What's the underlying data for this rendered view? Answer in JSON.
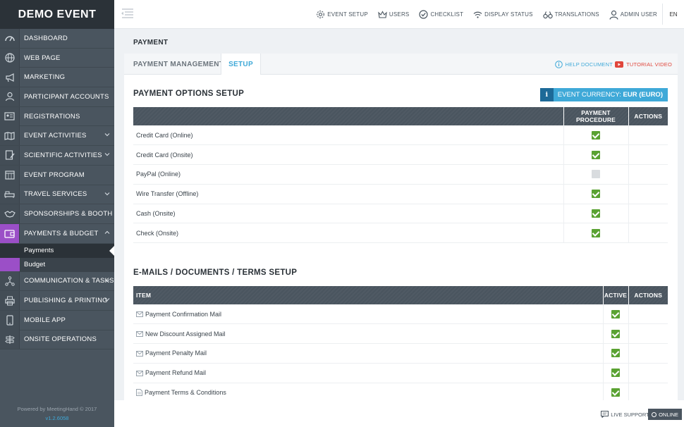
{
  "sidebar": {
    "brand": "DEMO EVENT",
    "items": [
      {
        "label": "DASHBOARD",
        "icon": "dashboard-icon"
      },
      {
        "label": "WEB PAGE",
        "icon": "globe-icon"
      },
      {
        "label": "MARKETING",
        "icon": "megaphone-icon"
      },
      {
        "label": "PARTICIPANT ACCOUNTS",
        "icon": "users-icon"
      },
      {
        "label": "REGISTRATIONS",
        "icon": "id-card-icon"
      },
      {
        "label": "EVENT ACTIVITIES",
        "icon": "map-icon"
      },
      {
        "label": "SCIENTIFIC ACTIVITIES",
        "icon": "document-pen-icon"
      },
      {
        "label": "EVENT PROGRAM",
        "icon": "calendar-icon"
      },
      {
        "label": "TRAVEL SERVICES",
        "icon": "bed-icon"
      },
      {
        "label": "SPONSORSHIPS & BOOTH",
        "icon": "handshake-icon"
      },
      {
        "label": "PAYMENTS & BUDGET",
        "icon": "wallet-icon"
      },
      {
        "label": "COMMUNICATION & TASKS",
        "icon": "network-icon"
      },
      {
        "label": "PUBLISHING & PRINTING",
        "icon": "printer-icon"
      },
      {
        "label": "MOBILE APP",
        "icon": "mobile-icon"
      },
      {
        "label": "ONSITE OPERATIONS",
        "icon": "signpost-icon"
      }
    ],
    "sub_items": [
      "Payments",
      "Budget"
    ],
    "footer": "Powered by MeetingHand © 2017",
    "version": "v1.2.6058"
  },
  "topbar": {
    "links": [
      "EVENT SETUP",
      "USERS",
      "CHECKLIST",
      "DISPLAY STATUS",
      "TRANSLATIONS",
      "ADMIN USER"
    ],
    "lang": "EN"
  },
  "page": {
    "title": "PAYMENT",
    "tabs": [
      "PAYMENT MANAGEMENT",
      "SETUP"
    ],
    "help_document": "HELP DOCUMENT",
    "tutorial_video": "TUTORIAL VIDEO"
  },
  "payment_options": {
    "title": "PAYMENT OPTIONS SETUP",
    "currency_label": "EVENT CURRENCY:",
    "currency_value": "EUR (EURO)",
    "headers": [
      "PAYMENT PROCEDURE",
      "ACTIONS"
    ],
    "rows": [
      {
        "name": "Credit Card (Online)",
        "enabled": true
      },
      {
        "name": "Credit Card (Onsite)",
        "enabled": true
      },
      {
        "name": "PayPal (Online)",
        "enabled": false
      },
      {
        "name": "Wire Transfer (Offline)",
        "enabled": true
      },
      {
        "name": "Cash (Onsite)",
        "enabled": true
      },
      {
        "name": "Check (Onsite)",
        "enabled": true
      }
    ]
  },
  "emails": {
    "title": "E-MAILS / DOCUMENTS / TERMS SETUP",
    "headers": [
      "ITEM",
      "ACTIVE",
      "ACTIONS"
    ],
    "rows": [
      {
        "name": "Payment Confirmation Mail",
        "icon": "mail-icon",
        "active": true
      },
      {
        "name": "New Discount Assigned Mail",
        "icon": "mail-icon",
        "active": true
      },
      {
        "name": "Payment Penalty Mail",
        "icon": "mail-icon",
        "active": true
      },
      {
        "name": "Payment Refund Mail",
        "icon": "mail-icon",
        "active": true
      },
      {
        "name": "Payment Terms & Conditions",
        "icon": "document-icon",
        "active": true
      }
    ]
  },
  "support": {
    "label": "LIVE SUPPORT:",
    "status": "ONLINE"
  },
  "colors": {
    "accent": "#3fa9d8",
    "sidebar": "#4a555f",
    "active_purple": "#9b4fc7",
    "check_green": "#5aa232"
  }
}
